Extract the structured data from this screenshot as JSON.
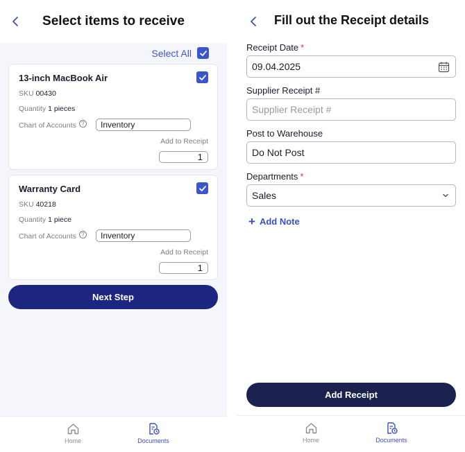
{
  "left": {
    "title": "Select items to receive",
    "select_all_label": "Select All",
    "items": [
      {
        "name": "13-inch MacBook Air",
        "sku_label": "SKU",
        "sku": "00430",
        "quantity_label": "Quantity",
        "quantity": "1 pieces",
        "coa_label": "Chart of Accounts",
        "coa_value": "Inventory",
        "add_label": "Add to Receipt",
        "add_value": "1",
        "checked": true
      },
      {
        "name": "Warranty Card",
        "sku_label": "SKU",
        "sku": "40218",
        "quantity_label": "Quantity",
        "quantity": "1 piece",
        "coa_label": "Chart of Accounts",
        "coa_value": "Inventory",
        "add_label": "Add to Receipt",
        "add_value": "1",
        "checked": true
      }
    ],
    "next_button": "Next Step"
  },
  "right": {
    "title": "Fill out the Receipt details",
    "receipt_date_label": "Receipt Date",
    "receipt_date_value": "09.04.2025",
    "supplier_receipt_label": "Supplier Receipt #",
    "supplier_receipt_placeholder": "Supplier Receipt #",
    "post_warehouse_label": "Post to Warehouse",
    "post_warehouse_value": "Do Not Post",
    "departments_label": "Departments",
    "departments_value": "Sales",
    "add_note": "Add Note",
    "add_receipt_button": "Add Receipt"
  },
  "required_marker": "*",
  "tabbar": {
    "home_label": "Home",
    "documents_label": "Documents"
  },
  "colors": {
    "accent": "#3b55cc",
    "primary_button": "#1c2580",
    "secondary_button": "#1c2250",
    "required": "#d23b3b"
  }
}
